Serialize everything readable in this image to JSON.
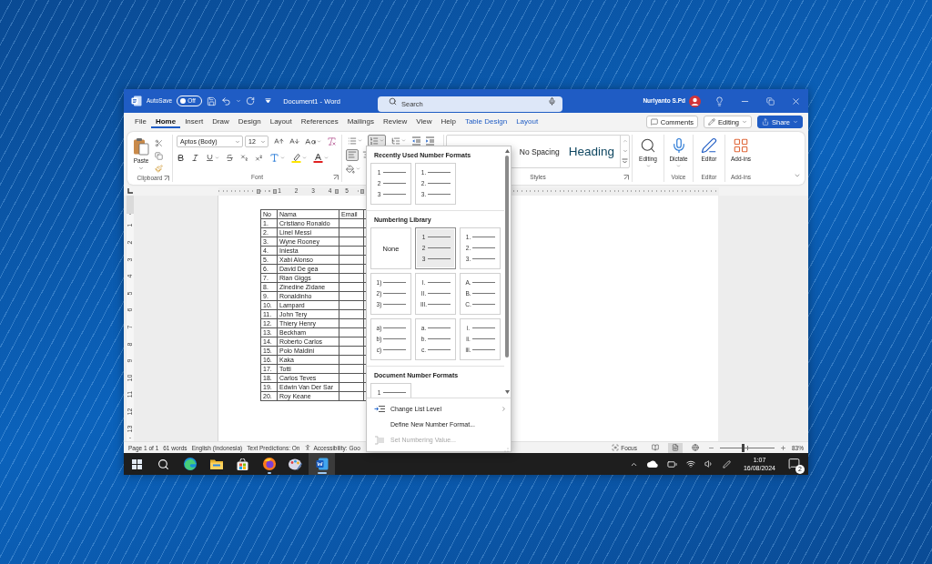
{
  "title_bar": {
    "autosave_label": "AutoSave",
    "autosave": {
      "label": "Off",
      "on": false
    },
    "document_title": "Document1 - Word",
    "search": {
      "placeholder": "Search"
    },
    "user_name": "Nurlyanto S.Pd"
  },
  "ribbon_tabs": [
    {
      "label": "File",
      "kind": "standard",
      "selected": false
    },
    {
      "label": "Home",
      "kind": "standard",
      "selected": true
    },
    {
      "label": "Insert",
      "kind": "standard",
      "selected": false
    },
    {
      "label": "Draw",
      "kind": "standard",
      "selected": false
    },
    {
      "label": "Design",
      "kind": "standard",
      "selected": false
    },
    {
      "label": "Layout",
      "kind": "standard",
      "selected": false
    },
    {
      "label": "References",
      "kind": "standard",
      "selected": false
    },
    {
      "label": "Mailings",
      "kind": "standard",
      "selected": false
    },
    {
      "label": "Review",
      "kind": "standard",
      "selected": false
    },
    {
      "label": "View",
      "kind": "standard",
      "selected": false
    },
    {
      "label": "Help",
      "kind": "standard",
      "selected": false
    },
    {
      "label": "Table Design",
      "kind": "contextual",
      "selected": false
    },
    {
      "label": "Layout",
      "kind": "contextual",
      "selected": false
    }
  ],
  "ribbon_actions": [
    {
      "label": "Comments",
      "kind": "comments"
    },
    {
      "label": "Editing",
      "kind": "mode"
    },
    {
      "label": "Share",
      "kind": "share"
    }
  ],
  "clipboard_group": {
    "paste_label": "Paste",
    "label": "Clipboard"
  },
  "font_group": {
    "font_name": "Aptos (Body)",
    "font_size": "12",
    "label": "Font"
  },
  "paragraph_group": {
    "list_buttons": [
      {
        "kind": "bullets",
        "on": false
      },
      {
        "kind": "numbering",
        "on": true
      },
      {
        "kind": "multilevel",
        "on": false
      }
    ],
    "align_buttons": [
      {
        "kind": "left",
        "selected": true
      },
      {
        "kind": "center",
        "selected": false
      }
    ]
  },
  "styles_group": {
    "styles": [
      {
        "label": "No Spacing",
        "kind": "body"
      },
      {
        "label": "Heading",
        "kind": "heading"
      }
    ],
    "label": "Styles"
  },
  "tool_groups": [
    {
      "kind": "editing",
      "button": "Editing"
    },
    {
      "kind": "dictate",
      "button": "Dictate",
      "label": "Voice"
    },
    {
      "kind": "editor",
      "button": "Editor",
      "label": "Editor"
    },
    {
      "kind": "addins",
      "button": "Add-ins",
      "label": "Add-ins"
    }
  ],
  "ruler": {
    "labels": [
      "1",
      "2",
      "3",
      "4",
      "5"
    ]
  },
  "vertical_ruler": {
    "labels": [
      "1",
      "2",
      "3",
      "4",
      "5",
      "6",
      "7",
      "8",
      "9",
      "10",
      "11",
      "12",
      "13"
    ]
  },
  "table": {
    "columns": [
      "No",
      "Nama",
      "Email"
    ],
    "rows": [
      {
        "no": "1.",
        "name": "Cristiano Ronaldo"
      },
      {
        "no": "2.",
        "name": "Linel Messi"
      },
      {
        "no": "3.",
        "name": "Wyne Rooney"
      },
      {
        "no": "4.",
        "name": "Iniesta"
      },
      {
        "no": "5.",
        "name": "Xabi Alonso"
      },
      {
        "no": "6.",
        "name": "David De gea"
      },
      {
        "no": "7.",
        "name": "Rian Giggs"
      },
      {
        "no": "8.",
        "name": "Zinedine Zidane"
      },
      {
        "no": "9.",
        "name": "Ronaldinho"
      },
      {
        "no": "10.",
        "name": "Lampard"
      },
      {
        "no": "11.",
        "name": "John Tery"
      },
      {
        "no": "12.",
        "name": "Thiery Henry"
      },
      {
        "no": "13.",
        "name": "Beckham"
      },
      {
        "no": "14.",
        "name": "Roberto Carlos"
      },
      {
        "no": "15.",
        "name": "Polo Maldini"
      },
      {
        "no": "16.",
        "name": "Kaka"
      },
      {
        "no": "17.",
        "name": "Totti"
      },
      {
        "no": "18.",
        "name": "Carlos Teves"
      },
      {
        "no": "19.",
        "name": "Edwin Van Der Sar"
      },
      {
        "no": "20.",
        "name": "Roy Keane"
      }
    ]
  },
  "numbering_menu": {
    "sections": [
      {
        "title": "Recently Used Number Formats",
        "formats": [
          {
            "kind": "list",
            "markers": [
              "1",
              "2",
              "3"
            ],
            "selected": false
          },
          {
            "kind": "list",
            "markers": [
              "1.",
              "2.",
              "3."
            ],
            "selected": false
          }
        ]
      },
      {
        "title": "Numbering Library",
        "formats": [
          {
            "kind": "none",
            "label": "None",
            "selected": false
          },
          {
            "kind": "list",
            "markers": [
              "1",
              "2",
              "3"
            ],
            "selected": true
          },
          {
            "kind": "list",
            "markers": [
              "1.",
              "2.",
              "3."
            ],
            "selected": false
          },
          {
            "kind": "list",
            "markers": [
              "1)",
              "2)",
              "3)"
            ],
            "selected": false
          },
          {
            "kind": "list",
            "markers": [
              "I.",
              "II.",
              "III."
            ],
            "selected": false
          },
          {
            "kind": "list",
            "markers": [
              "A.",
              "B.",
              "C."
            ],
            "selected": false
          },
          {
            "kind": "list",
            "markers": [
              "a)",
              "b)",
              "c)"
            ],
            "selected": false
          },
          {
            "kind": "list",
            "markers": [
              "a.",
              "b.",
              "c."
            ],
            "selected": false
          },
          {
            "kind": "list",
            "markers": [
              "i.",
              "ii.",
              "iii."
            ],
            "selected": false
          }
        ]
      },
      {
        "title": "Document Number Formats",
        "formats": [
          {
            "kind": "list",
            "markers": [
              "1"
            ],
            "selected": false
          }
        ]
      }
    ],
    "commands": [
      {
        "label": "Change List Level",
        "kind": "level",
        "disabled": false,
        "submenu": true
      },
      {
        "label": "Define New Number Format...",
        "kind": "define",
        "disabled": false,
        "submenu": false
      },
      {
        "label": "Set Numbering Value...",
        "kind": "value",
        "disabled": true,
        "submenu": false
      }
    ]
  },
  "status_bar": {
    "items": [
      "Page 1 of 1",
      "61 words",
      "English (Indonesia)",
      "Text Predictions: On"
    ],
    "accessibility": "Accessibility: Goo",
    "focus": "Focus",
    "views": [
      {
        "kind": "read",
        "selected": false
      },
      {
        "kind": "print",
        "selected": true
      },
      {
        "kind": "web",
        "selected": false
      }
    ],
    "zoom": {
      "level": 0.42,
      "reading": "83%"
    }
  },
  "taskbar": {
    "apps": [
      {
        "kind": "start",
        "running": false,
        "selected": false
      },
      {
        "kind": "search",
        "running": false,
        "selected": false
      },
      {
        "kind": "edge",
        "running": false,
        "selected": false
      },
      {
        "kind": "explorer",
        "running": false,
        "selected": false
      },
      {
        "kind": "store",
        "running": false,
        "selected": false
      },
      {
        "kind": "firefox",
        "running": true,
        "selected": false
      },
      {
        "kind": "paint",
        "running": false,
        "selected": false
      },
      {
        "kind": "word",
        "running": true,
        "selected": true
      }
    ],
    "clock": {
      "time": "1:07",
      "date": "16/08/2024"
    },
    "notification_count": "2"
  }
}
